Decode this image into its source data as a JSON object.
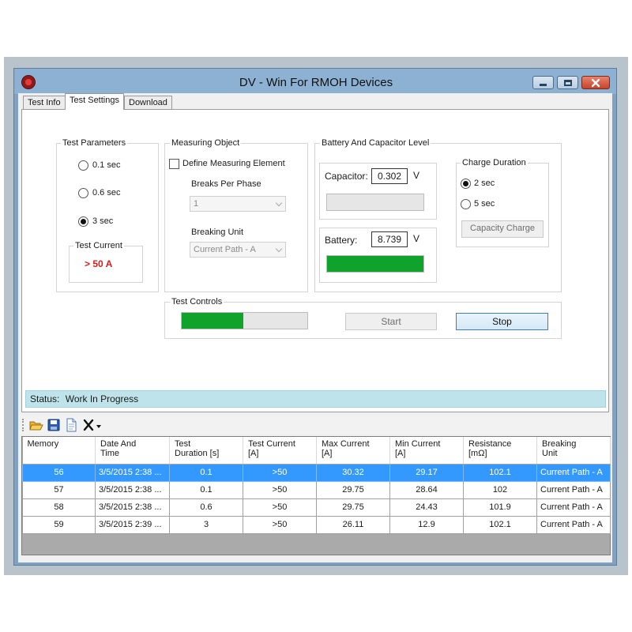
{
  "window": {
    "title": "DV - Win For RMOH Devices"
  },
  "tabs": [
    {
      "label": "Test Info",
      "active": false
    },
    {
      "label": "Test Settings",
      "active": true
    },
    {
      "label": "Download",
      "active": false
    }
  ],
  "test_parameters": {
    "title": "Test Parameters",
    "options": [
      {
        "label": "0.1 sec",
        "checked": false
      },
      {
        "label": "0.6 sec",
        "checked": false
      },
      {
        "label": "3 sec",
        "checked": true
      }
    ],
    "test_current": {
      "title": "Test Current",
      "value": "> 50 A",
      "color": "#d11f1f"
    }
  },
  "measuring_object": {
    "title": "Measuring Object",
    "define_label": "Define Measuring Element",
    "define_checked": false,
    "breaks_label": "Breaks Per Phase",
    "breaks_value": "1",
    "unit_label": "Breaking Unit",
    "unit_value": "Current Path - A"
  },
  "battery_capacitor": {
    "title": "Battery And Capacitor Level",
    "capacitor_label": "Capacitor:",
    "capacitor_value": "0.302",
    "capacitor_unit": "V",
    "capacitor_level": 0.0,
    "battery_label": "Battery:",
    "battery_value": "8.739",
    "battery_unit": "V",
    "battery_level": 1.0,
    "level_color": "#0fa32b"
  },
  "charge_duration": {
    "title": "Charge Duration",
    "options": [
      {
        "label": "2 sec",
        "checked": true
      },
      {
        "label": "5 sec",
        "checked": false
      }
    ],
    "button_label": "Capacity Charge"
  },
  "test_controls": {
    "title": "Test Controls",
    "progress": 0.49,
    "progress_color": "#0fa32b",
    "start_label": "Start",
    "stop_label": "Stop"
  },
  "status": {
    "label": "Status:",
    "value": "Work In Progress"
  },
  "toolbar": {
    "icons": [
      "open-folder-icon",
      "save-icon",
      "document-icon",
      "delete-icon"
    ]
  },
  "table": {
    "columns": [
      [
        "Memory"
      ],
      [
        "Date And",
        "Time"
      ],
      [
        "Test",
        "Duration [s]"
      ],
      [
        "Test Current",
        "[A]"
      ],
      [
        "Max Current",
        "[A]"
      ],
      [
        "Min Current",
        "[A]"
      ],
      [
        "Resistance",
        "[mΩ]"
      ],
      [
        "Breaking",
        "Unit"
      ]
    ],
    "rows": [
      [
        "56",
        "3/5/2015 2:38 ...",
        "0.1",
        ">50",
        "30.32",
        "29.17",
        "102.1",
        "Current Path - A"
      ],
      [
        "57",
        "3/5/2015 2:38 ...",
        "0.1",
        ">50",
        "29.75",
        "28.64",
        "102",
        "Current Path - A"
      ],
      [
        "58",
        "3/5/2015 2:38 ...",
        "0.6",
        ">50",
        "29.75",
        "24.43",
        "101.9",
        "Current Path - A"
      ],
      [
        "59",
        "3/5/2015 2:39 ...",
        "3",
        ">50",
        "26.11",
        "12.9",
        "102.1",
        "Current Path - A"
      ]
    ],
    "selected_row": 0
  }
}
